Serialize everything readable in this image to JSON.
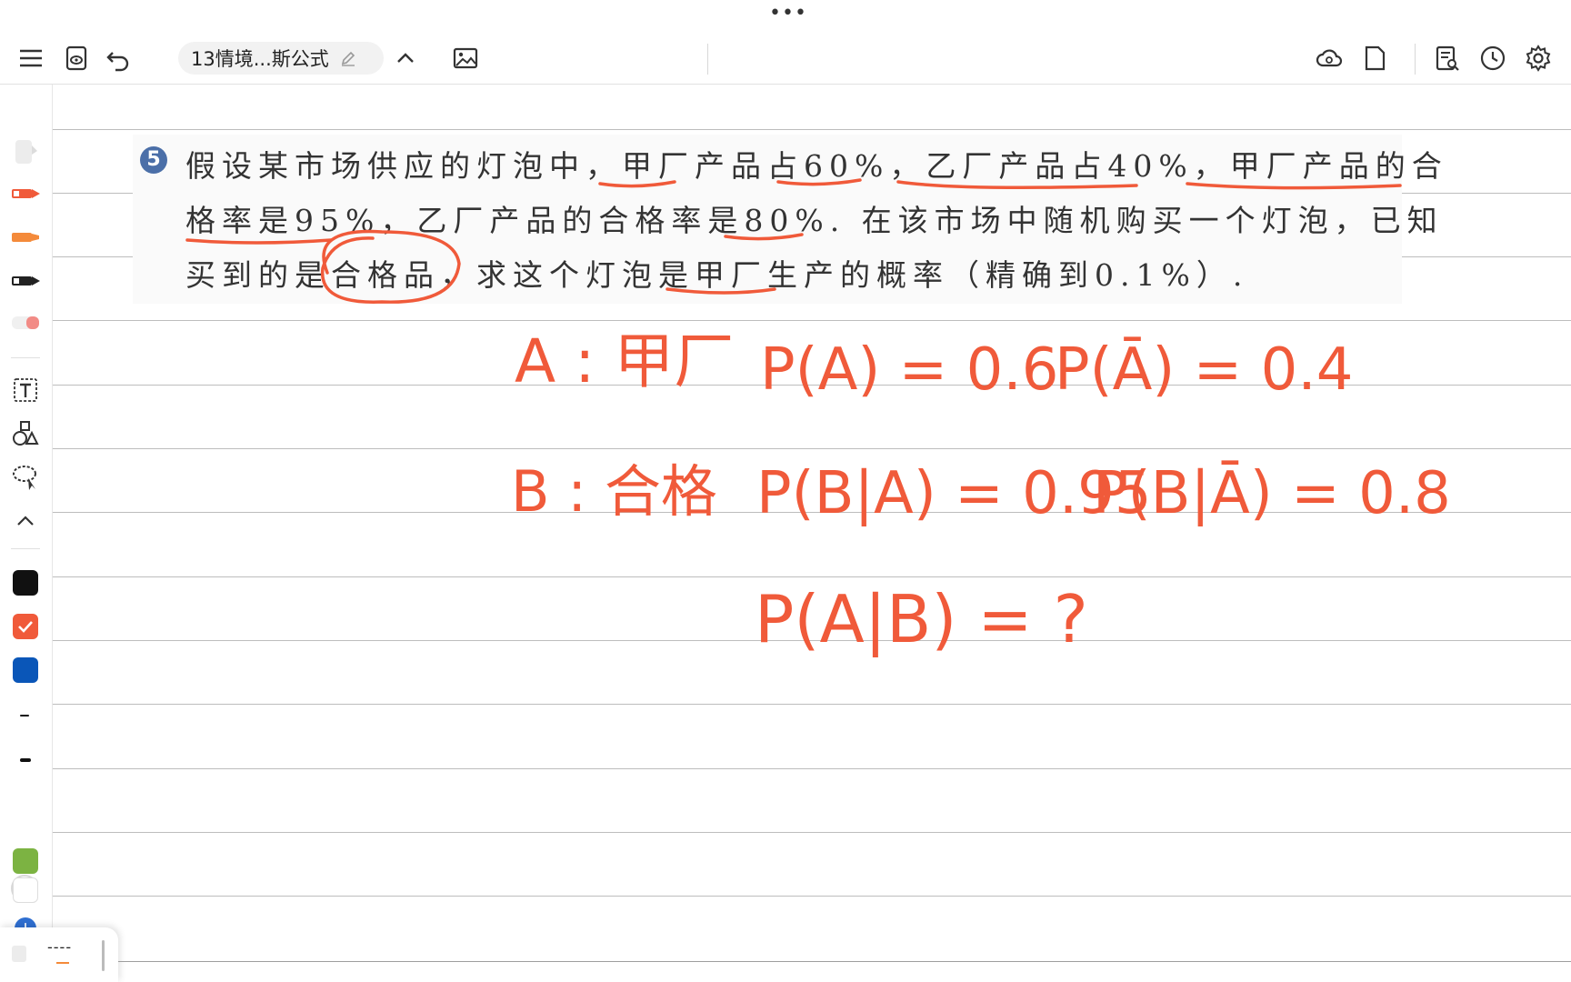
{
  "window": {
    "more_dots": "•••"
  },
  "toolbar": {
    "doc_title": "13情境...斯公式",
    "left_icons": [
      "menu-icon",
      "preview-icon",
      "undo-icon"
    ],
    "right_icons": [
      "cloud-sync-icon",
      "page-icon",
      "search-note-icon",
      "history-icon",
      "settings-icon"
    ]
  },
  "sidebar": {
    "tools": [
      "pen-light-icon",
      "pen-red-icon",
      "marker-orange-icon",
      "pen-dark-icon",
      "eraser-icon",
      "text-tool-icon",
      "shapes-icon",
      "lasso-icon",
      "collapse-icon"
    ],
    "colors": [
      "#111111",
      "#f05a3a",
      "#0a56b8",
      "#7cb342",
      "#ffffff"
    ],
    "selected_color": "#f05a3a",
    "bottom_label": "----"
  },
  "problem": {
    "number": "5",
    "line1": "假设某市场供应的灯泡中，甲厂产品占60%，乙厂产品占40%，甲厂产品的合",
    "line2": "格率是95%，乙厂产品的合格率是80%. 在该市场中随机购买一个灯泡，已知",
    "line3": "买到的是合格品，求这个灯泡是甲厂生产的概率（精确到0.1%）."
  },
  "handwriting": {
    "a_def": "A : 甲厂",
    "b_def": "B : 合格",
    "pa": "P(A) = 0.6",
    "pnota": "P(Ā) = 0.4",
    "pba": "P(B|A) = 0.95",
    "pbnota": "P(B|Ā) = 0.8",
    "pab": "P(A|B) = ?"
  }
}
